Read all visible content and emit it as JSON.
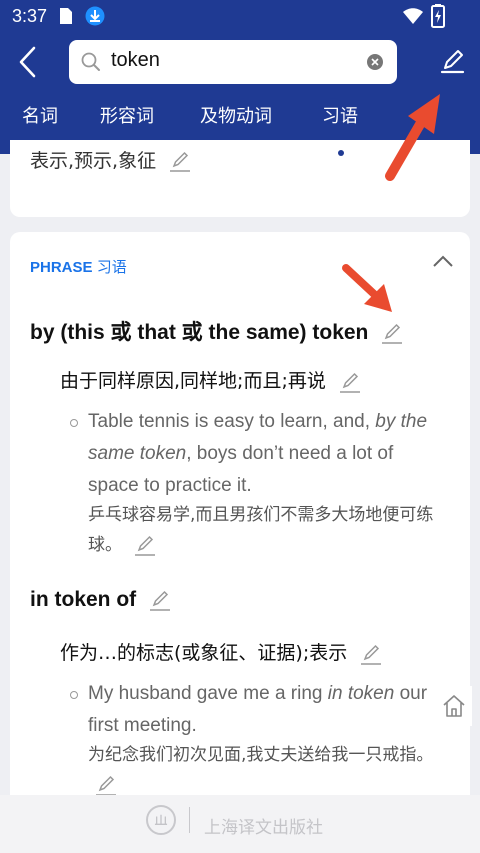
{
  "status_bar": {
    "time": "3:37"
  },
  "search": {
    "query": "token"
  },
  "tabs": [
    {
      "label": "名词"
    },
    {
      "label": "形容词"
    },
    {
      "label": "及物动词"
    },
    {
      "label": "习语"
    }
  ],
  "top_card": {
    "clipped_text": "表示,预示,象征"
  },
  "phrase_section": {
    "label_en": "PHRASE",
    "label_cn": "习语",
    "entries": [
      {
        "phrase": "by (this 或 that 或 the same) token",
        "definition": "由于同样原因,同样地;而且;再说",
        "example_before": "Table tennis is easy to learn, and, ",
        "example_italic": "by the same token",
        "example_after": ", boys don’t need a lot of space to practice it.",
        "example_cn": "乒乓球容易学,而且男孩们不需多大场地便可练球。"
      },
      {
        "phrase": "in token of",
        "definition": "作为…的标志(或象征、证据);表示",
        "example_before": "My husband gave me a ring ",
        "example_italic": "in token",
        "example_after": " our first meeting.",
        "example_cn": "为纪念我们初次见面,我丈夫送给我一只戒指。"
      }
    ]
  },
  "footer": {
    "publisher": "上海译文出版社"
  },
  "colors": {
    "brand": "#1f3a93",
    "accent": "#1a73e8",
    "arrow": "#e94b2f"
  }
}
